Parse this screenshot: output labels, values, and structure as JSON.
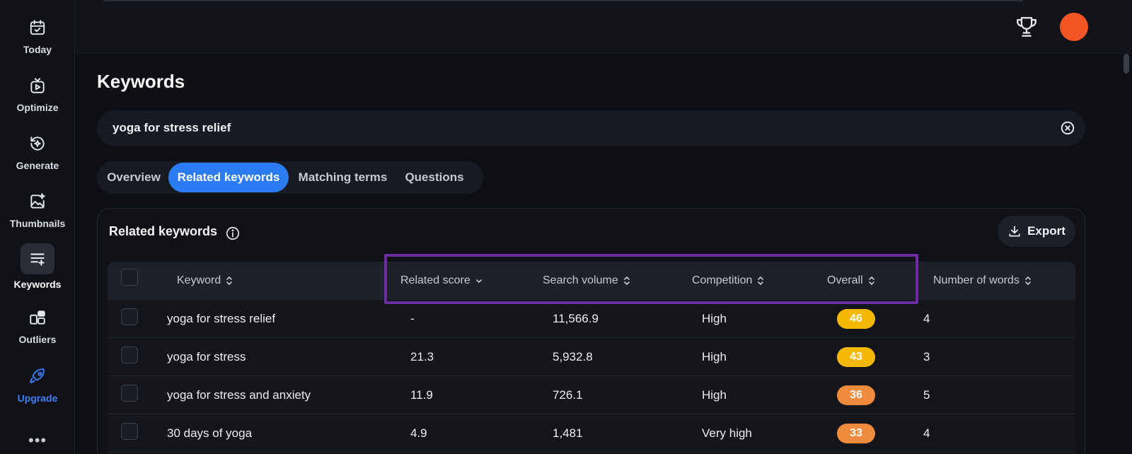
{
  "sidebar": {
    "items": [
      {
        "label": "Today",
        "icon": "calendar-check-icon"
      },
      {
        "label": "Optimize",
        "icon": "video-play-icon"
      },
      {
        "label": "Generate",
        "icon": "sparkle-refresh-icon"
      },
      {
        "label": "Thumbnails",
        "icon": "image-sparkle-icon"
      },
      {
        "label": "Keywords",
        "icon": "list-add-icon"
      },
      {
        "label": "Outliers",
        "icon": "grid-chart-icon"
      },
      {
        "label": "Upgrade",
        "icon": "rocket-icon"
      }
    ],
    "more": "•••"
  },
  "page": {
    "title": "Keywords"
  },
  "search": {
    "value": "yoga for stress relief"
  },
  "tabs": [
    {
      "label": "Overview"
    },
    {
      "label": "Related keywords"
    },
    {
      "label": "Matching terms"
    },
    {
      "label": "Questions"
    }
  ],
  "card": {
    "title": "Related keywords",
    "export_label": "Export"
  },
  "table": {
    "columns": [
      "Keyword",
      "Related score",
      "Search volume",
      "Competition",
      "Overall",
      "Number of words"
    ],
    "rows": [
      {
        "keyword": "yoga for stress relief",
        "related_score": "-",
        "search_volume": "11,566.9",
        "competition": "High",
        "overall": "46",
        "words": "4"
      },
      {
        "keyword": "yoga for stress",
        "related_score": "21.3",
        "search_volume": "5,932.8",
        "competition": "High",
        "overall": "43",
        "words": "3"
      },
      {
        "keyword": "yoga for stress and anxiety",
        "related_score": "11.9",
        "search_volume": "726.1",
        "competition": "High",
        "overall": "36",
        "words": "5"
      },
      {
        "keyword": "30 days of yoga",
        "related_score": "4.9",
        "search_volume": "1,481",
        "competition": "Very high",
        "overall": "33",
        "words": "4"
      }
    ]
  },
  "colors": {
    "accent": "#2b7bf4",
    "avatar": "#f25524",
    "overall_yellow": "#f5b800",
    "overall_orange": "#f08a3c",
    "highlight": "#6a2ea0"
  }
}
